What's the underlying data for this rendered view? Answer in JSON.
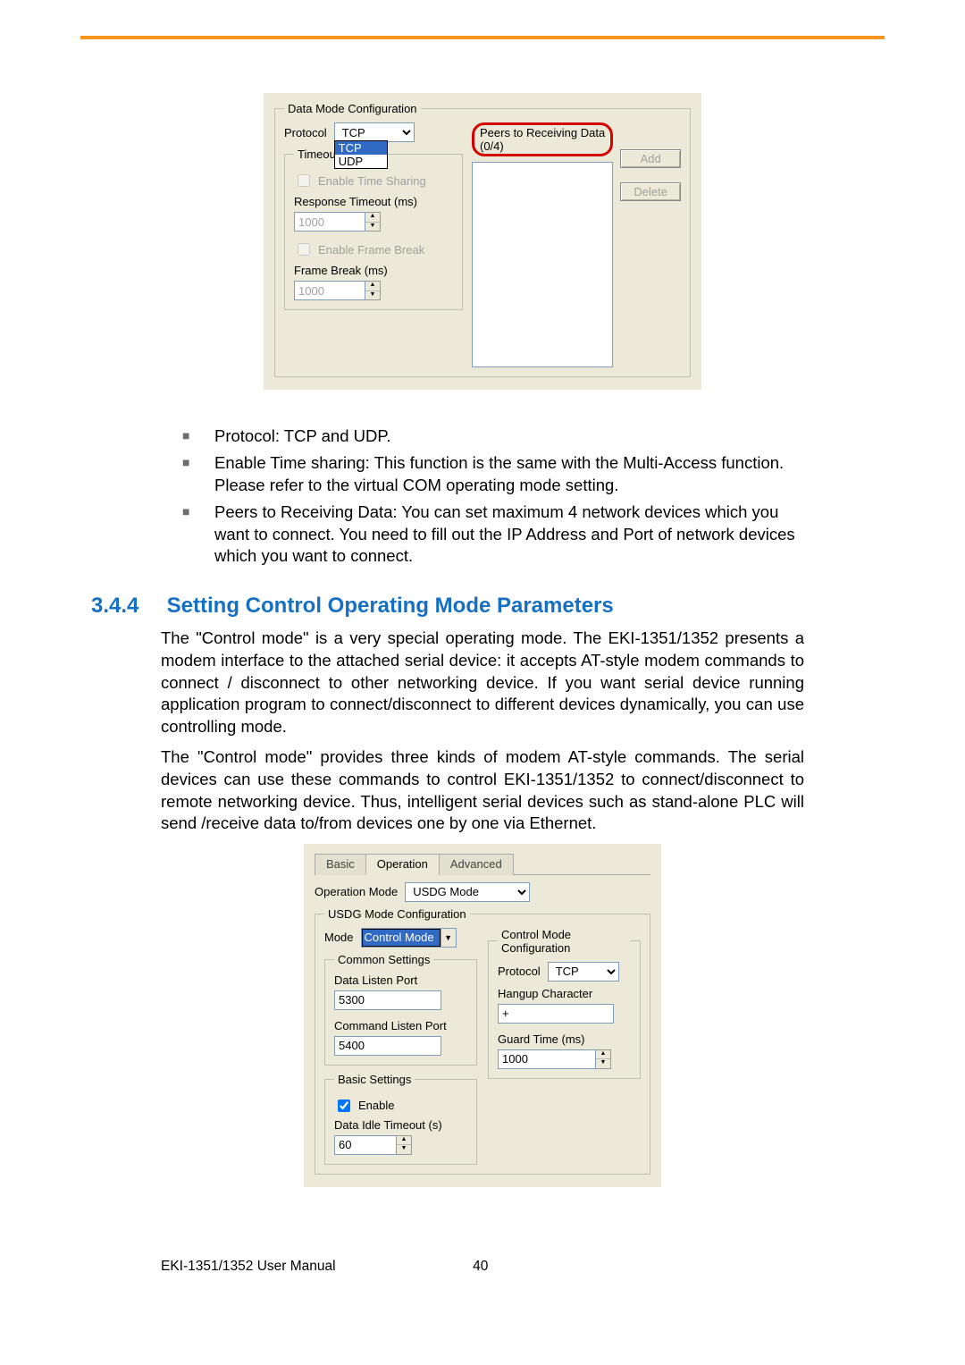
{
  "screenshot1": {
    "group_title": "Data Mode Configuration",
    "protocol_label": "Protocol",
    "protocol_value": "TCP",
    "protocol_options": {
      "opt_hl": "TCP",
      "opt_other": "UDP"
    },
    "timeout_group": "Timeout Settings",
    "enable_time_sharing": "Enable Time Sharing",
    "response_timeout_label": "Response Timeout (ms)",
    "response_timeout_value": "1000",
    "enable_frame_break": "Enable Frame Break",
    "frame_break_label": "Frame Break (ms)",
    "frame_break_value": "1000",
    "peers_title": "Peers to Receiving Data (0/4)",
    "add_btn": "Add",
    "delete_btn": "Delete"
  },
  "bullets": {
    "b1": "Protocol: TCP and UDP.",
    "b2": "Enable Time sharing: This function is the same with the Multi-Access function. Please refer to the virtual COM operating mode setting.",
    "b3": "Peers to Receiving Data: You can set maximum 4 network devices which you want to connect. You need to fill out the IP Address and Port of network devices which you want to connect."
  },
  "section": {
    "num": "3.4.4",
    "title": "Setting Control Operating Mode Parameters",
    "p1": "The \"Control mode\" is a very special operating mode. The EKI-1351/1352 presents a modem interface to the attached serial device: it accepts AT-style modem commands to connect / disconnect to other networking device. If you want serial device running application program to connect/disconnect to different devices dynamically, you can use controlling mode.",
    "p2": "The \"Control mode\" provides three kinds of modem AT-style commands. The serial devices can use these commands to control EKI-1351/1352 to connect/disconnect to remote networking device. Thus, intelligent serial devices such as stand-alone PLC will send /receive data to/from devices one by one via Ethernet."
  },
  "screenshot2": {
    "tabs": {
      "basic": "Basic",
      "operation": "Operation",
      "advanced": "Advanced"
    },
    "op_mode_label": "Operation Mode",
    "op_mode_value": "USDG Mode",
    "usdg_group": "USDG Mode Configuration",
    "mode_label": "Mode",
    "mode_value": "Control Mode",
    "common_group": "Common Settings",
    "data_listen_label": "Data Listen Port",
    "data_listen_value": "5300",
    "cmd_listen_label": "Command Listen Port",
    "cmd_listen_value": "5400",
    "basic_group": "Basic Settings",
    "enable_label": "Enable",
    "idle_label": "Data Idle Timeout (s)",
    "idle_value": "60",
    "ctrl_group": "Control Mode Configuration",
    "protocol_label": "Protocol",
    "protocol_value": "TCP",
    "hangup_label": "Hangup Character",
    "hangup_value": "+",
    "guard_label": "Guard Time (ms)",
    "guard_value": "1000"
  },
  "footer": {
    "manual": "EKI-1351/1352 User Manual",
    "page": "40"
  }
}
